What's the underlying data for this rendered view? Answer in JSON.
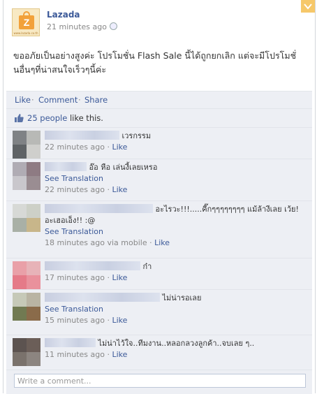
{
  "post": {
    "page_name": "Lazada",
    "logo_text": "Z",
    "logo_url": "www.lazada.co.th",
    "time": "21 minutes ago",
    "text": "ขออภัยเป็นอย่างสูงค่ะ โปรโมชั่น Flash Sale นี้ได้ถูกยกเลิก แต่จะมีโปรโมชั่นอื่นๆที่น่าสนใจเร็วๆนี้ค่ะ"
  },
  "actions": {
    "like": "Like",
    "comment": "Comment",
    "share": "Share",
    "sep": "·"
  },
  "likes": {
    "people_count": "25 people",
    "suffix": "like this."
  },
  "comments": [
    {
      "text": "เวรกรรม",
      "time": "22 minutes ago",
      "like": "Like",
      "see_translation": "",
      "via": ""
    },
    {
      "text": "อ๊อ หือ เล่นงี้เลยเหรอ",
      "time": "22 minutes ago",
      "like": "Like",
      "see_translation": "See Translation",
      "via": ""
    },
    {
      "text": "อะไรวะ!!!.....คี๊กๆๆๆๆๆๆๆๆ แม้ล้างีเลย เว้ย! อะเฮอเอ็ง!! :@",
      "time": "18 minutes ago",
      "like": "Like",
      "see_translation": "See Translation",
      "via": "via mobile"
    },
    {
      "text": "ก๋า",
      "time": "17 minutes ago",
      "like": "Like",
      "see_translation": "",
      "via": ""
    },
    {
      "text": "ไม่น่ารอเลย",
      "time": "15 minutes ago",
      "like": "Like",
      "see_translation": "See Translation",
      "via": ""
    },
    {
      "text": "ไม่น่าไว้ใจ..ทีมงาน..หลอกลวงลูกค้า..จบเลย ๆ..",
      "time": "11 minutes ago",
      "like": "Like",
      "see_translation": "",
      "via": ""
    }
  ],
  "write_comment": {
    "placeholder": "Write a comment..."
  },
  "colors": {
    "link": "#3b5998",
    "panel": "#edeff4",
    "corner": "#f6c86a"
  }
}
